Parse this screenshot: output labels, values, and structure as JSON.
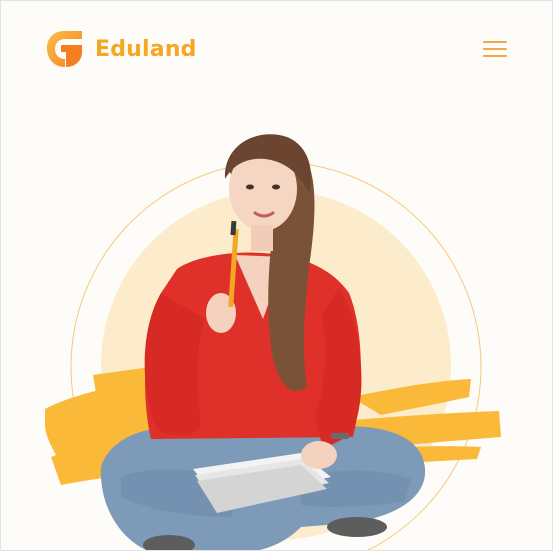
{
  "header": {
    "brand_name": "Eduland",
    "menu_icon": "hamburger-menu-icon"
  },
  "hero": {
    "image": "student-girl-with-pencil-and-notebook"
  },
  "colors": {
    "brand": "#f5a623",
    "logo_light": "#fbbf4a",
    "logo_dark": "#f57f20",
    "menu_icon": "#f0a84c",
    "hero_circle_fill": "#fdeccc",
    "hero_circle_outline": "#f7c97b",
    "brush_stroke": "#fbb939",
    "background": "#fdfcf8"
  }
}
